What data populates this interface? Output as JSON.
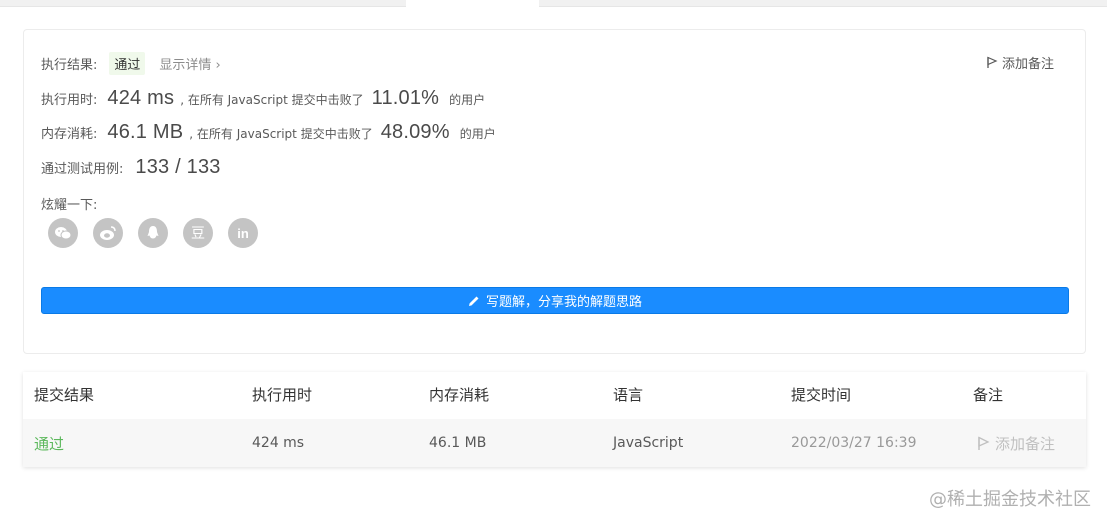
{
  "result": {
    "label": "执行结果:",
    "status": "通过",
    "detail_link": "显示详情 ›",
    "add_note": "添加备注"
  },
  "runtime": {
    "label": "执行用时:",
    "value": "424 ms",
    "mid_text": ", 在所有 JavaScript 提交中击败了",
    "percent": "11.01%",
    "suffix": "的用户"
  },
  "memory": {
    "label": "内存消耗:",
    "value": "46.1 MB",
    "mid_text": ", 在所有 JavaScript 提交中击败了",
    "percent": "48.09%",
    "suffix": "的用户"
  },
  "tests": {
    "label": "通过测试用例:",
    "value": "133 / 133"
  },
  "share": {
    "label": "炫耀一下:",
    "icons": [
      "wechat-icon",
      "weibo-icon",
      "qq-icon",
      "douban-icon",
      "linkedin-icon"
    ],
    "douban_glyph": "豆",
    "linkedin_glyph": "in"
  },
  "write_button": "写题解，分享我的解题思路",
  "table": {
    "headers": [
      "提交结果",
      "执行用时",
      "内存消耗",
      "语言",
      "提交时间",
      "备注"
    ],
    "row": {
      "status": "通过",
      "runtime": "424 ms",
      "memory": "46.1 MB",
      "language": "JavaScript",
      "time": "2022/03/27 16:39",
      "note": "添加备注"
    }
  },
  "watermark": "@稀土掘金技术社区",
  "colors": {
    "accent": "#1a8cff",
    "success": "#5cb85c",
    "pass_tag_bg": "#f0f9eb",
    "share_icon_bg": "#c4c4c4"
  }
}
